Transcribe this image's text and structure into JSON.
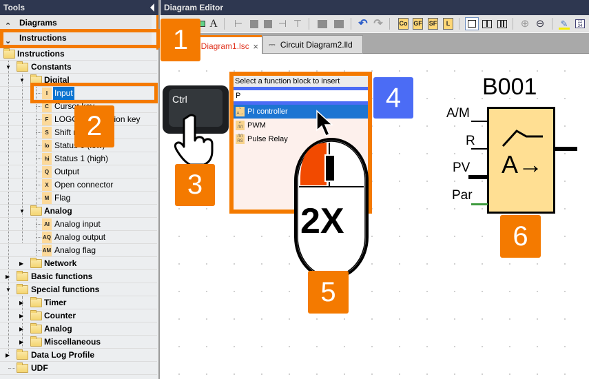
{
  "tools_panel": {
    "title": "Tools",
    "sections": [
      {
        "label": "Diagrams",
        "state": "collapsed"
      },
      {
        "label": "Instructions",
        "state": "expanded"
      }
    ],
    "tree": {
      "root": "Instructions",
      "constants": "Constants",
      "digital": "Digital",
      "digital_items": [
        {
          "badge": "I",
          "label": "Input",
          "selected": true
        },
        {
          "badge": "C",
          "label": "Cursor key"
        },
        {
          "badge": "F",
          "label": "LOGO! TD function key"
        },
        {
          "badge": "S",
          "label": "Shift register"
        },
        {
          "badge": "lo",
          "label": "Status 0 (low)"
        },
        {
          "badge": "hi",
          "label": "Status 1 (high)"
        },
        {
          "badge": "Q",
          "label": "Output"
        },
        {
          "badge": "X",
          "label": "Open connector"
        },
        {
          "badge": "M",
          "label": "Flag"
        }
      ],
      "analog": "Analog",
      "analog_items": [
        {
          "badge": "AI",
          "label": "Analog input"
        },
        {
          "badge": "AQ",
          "label": "Analog output"
        },
        {
          "badge": "AM",
          "label": "Analog flag"
        }
      ],
      "network": "Network",
      "basic_functions": "Basic functions",
      "special_functions": "Special functions",
      "special_items": [
        "Timer",
        "Counter",
        "Analog",
        "Miscellaneous"
      ],
      "data_log_profile": "Data Log Profile",
      "udf": "UDF"
    }
  },
  "editor": {
    "title": "Diagram Editor",
    "toolbar": {
      "text_tool": "A",
      "block_buttons": [
        "Co",
        "GF",
        "SF",
        "L"
      ]
    },
    "tabs": [
      {
        "label": "Circuit Diagram1.lsc",
        "visible_label": "t Diagram1.lsc",
        "active": true,
        "close": "×"
      },
      {
        "label": "Circuit Diagram2.lld",
        "active": false
      }
    ],
    "insert_dialog": {
      "header": "Select a function block to insert",
      "input_value": "P",
      "items": [
        {
          "label": "PI controller",
          "icon": "A→",
          "selected": true
        },
        {
          "label": "PWM",
          "icon": "PWM"
        },
        {
          "label": "Pulse Relay",
          "icon": "RS"
        }
      ]
    },
    "keyboard_key": "Ctrl",
    "mouse_label": "2X",
    "function_block": {
      "name": "B001",
      "symbol": "A→",
      "pins": [
        "A/M",
        "R",
        "PV",
        "Par"
      ]
    }
  },
  "callouts": [
    "1",
    "2",
    "3",
    "4",
    "5",
    "6"
  ],
  "colors": {
    "accent_orange": "#f47a00",
    "callout_blue": "#4b6cf5",
    "selection_blue": "#0a73d0",
    "title_bar": "#2e3750",
    "block_fill": "#ffdf93"
  }
}
